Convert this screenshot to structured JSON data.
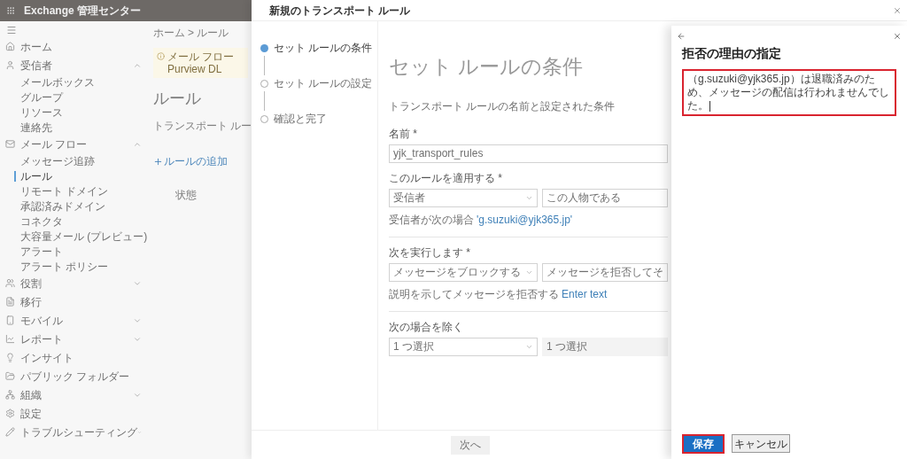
{
  "app_bar": {
    "title": "Exchange 管理センター"
  },
  "sidebar": {
    "items": [
      {
        "label": "ホーム"
      },
      {
        "label": "受信者",
        "expanded": true,
        "children": [
          {
            "label": "メールボックス",
            "selected": false
          },
          {
            "label": "グループ",
            "selected": false
          },
          {
            "label": "リソース",
            "selected": false
          },
          {
            "label": "連絡先",
            "selected": false
          }
        ]
      },
      {
        "label": "メール フロー",
        "expanded": true,
        "children": [
          {
            "label": "メッセージ追跡",
            "selected": false
          },
          {
            "label": "ルール",
            "selected": true
          },
          {
            "label": "リモート ドメイン",
            "selected": false
          },
          {
            "label": "承認済みドメイン",
            "selected": false
          },
          {
            "label": "コネクタ",
            "selected": false
          },
          {
            "label": "大容量メール (プレビュー)",
            "selected": false
          },
          {
            "label": "アラート",
            "selected": false
          },
          {
            "label": "アラート ポリシー",
            "selected": false
          }
        ]
      },
      {
        "label": "役割",
        "expanded": false
      },
      {
        "label": "移行"
      },
      {
        "label": "モバイル",
        "expanded": false
      },
      {
        "label": "レポート",
        "expanded": false
      },
      {
        "label": "インサイト"
      },
      {
        "label": "パブリック フォルダー"
      },
      {
        "label": "組織",
        "expanded": false
      },
      {
        "label": "設定"
      },
      {
        "label": "トラブルシューティング",
        "expanded": false
      }
    ]
  },
  "main": {
    "breadcrumb": [
      "ホーム",
      "ルール"
    ],
    "breadcrumb_separator": ">",
    "notice": [
      "メール フロー",
      "Purview DL"
    ],
    "heading": "ルール",
    "description": "トランスポート ルー",
    "add_button": "ルールの追加",
    "column_1": "状態"
  },
  "wizard": {
    "title": "新規のトランスポート ルール",
    "steps": [
      {
        "label": "セット ルールの条件",
        "selected": true
      },
      {
        "label": "セット ルールの設定",
        "selected": false
      },
      {
        "label": "確認と完了",
        "selected": false
      }
    ],
    "heading": "セット ルールの条件",
    "description": "トランスポート ルールの名前と設定された条件",
    "name_label": "名前 *",
    "name_value": "yjk_transport_rules",
    "apply_label": "このルールを適用する *",
    "apply_select": "受信者",
    "apply_select_2": "この人物である",
    "apply_note": "受信者が次の場合",
    "apply_link": "'g.suzuki@yjk365.jp'",
    "do_label": "次を実行します *",
    "do_select": "メッセージをブロックする",
    "do_select_2": "メッセージを拒否してそ",
    "do_note": "説明を示してメッセージを拒否する",
    "do_link": "Enter text",
    "except_label": "次の場合を除く",
    "except_select": "1 つ選択",
    "except_select_2": "1 つ選択",
    "next_button": "次へ"
  },
  "panel": {
    "heading": "拒否の理由の指定",
    "reason_value": "（g.suzuki@yjk365.jp）は退職済みのため、メッセージの配信は行われませんでした。",
    "save_button": "保存",
    "cancel_button": "キャンセル"
  }
}
